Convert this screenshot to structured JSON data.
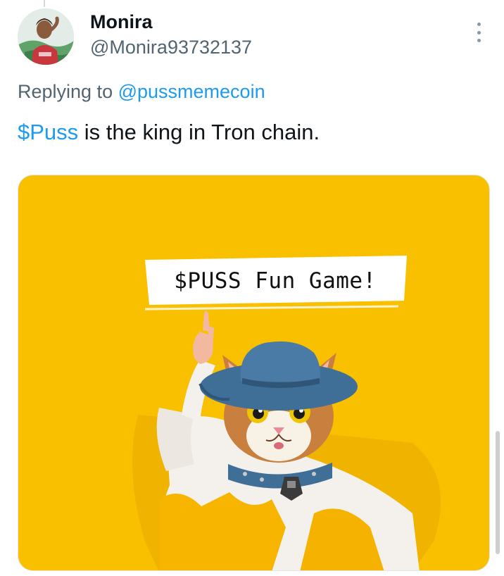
{
  "tweet": {
    "author_name": "Monira",
    "author_handle": "@Monira93732137",
    "reply_prefix": "Replying to ",
    "reply_to": "@pussmemecoin",
    "text_cashtag": "$Puss",
    "text_rest": " is the king in Tron chain.",
    "more_icon": "more-vertical-icon"
  },
  "media": {
    "banner_text": "$PUSS Fun Game!",
    "background_color": "#f9c000",
    "description_icon": "cat-in-hat-illustration"
  },
  "colors": {
    "link": "#1d9bf0",
    "secondary_text": "#536471",
    "primary_text": "#0f1419"
  }
}
